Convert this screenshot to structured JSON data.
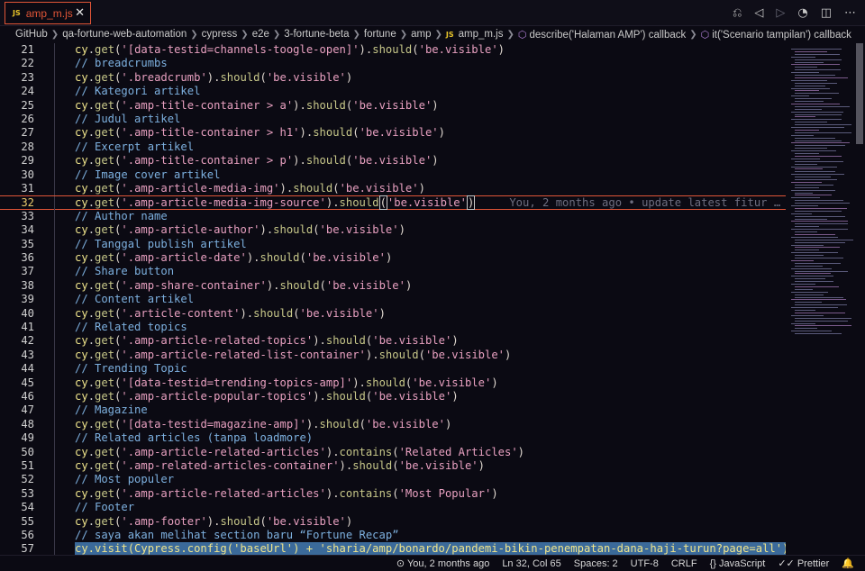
{
  "tab": {
    "icon": "JS",
    "name": "amp_m.js",
    "close": "✕"
  },
  "toolbar": [
    {
      "name": "source-control-icon",
      "glyph": "⎌"
    },
    {
      "name": "go-back-icon",
      "glyph": "◁"
    },
    {
      "name": "go-forward-icon",
      "glyph": "▷"
    },
    {
      "name": "timeline-icon",
      "glyph": "◔"
    },
    {
      "name": "split-editor-icon",
      "glyph": "◫"
    },
    {
      "name": "more-actions-icon",
      "glyph": "⋯"
    }
  ],
  "breadcrumb": [
    {
      "text": "GitHub"
    },
    {
      "text": "qa-fortune-web-automation"
    },
    {
      "text": "cypress"
    },
    {
      "text": "e2e"
    },
    {
      "text": "3-fortune-beta"
    },
    {
      "text": "fortune"
    },
    {
      "text": "amp"
    },
    {
      "text": "amp_m.js",
      "js": "JS"
    },
    {
      "text": "describe('Halaman AMP') callback",
      "sym": "⬡"
    },
    {
      "text": "it('Scenario tampilan') callback",
      "sym": "⬡"
    }
  ],
  "blame": "You, 2 months ago • update latest fitur …",
  "lines": [
    {
      "n": "21",
      "cy": "cy",
      "m1": "get",
      "a1": "'[data-testid=channels-toogle-open]'",
      "m2": "should",
      "a2": "'be.visible'"
    },
    {
      "n": "22",
      "comment": "// breadcrumbs"
    },
    {
      "n": "23",
      "cy": "cy",
      "m1": "get",
      "a1": "'.breadcrumb'",
      "m2": "should",
      "a2": "'be.visible'"
    },
    {
      "n": "24",
      "comment": "// Kategori artikel"
    },
    {
      "n": "25",
      "cy": "cy",
      "m1": "get",
      "a1": "'.amp-title-container > a'",
      "m2": "should",
      "a2": "'be.visible'"
    },
    {
      "n": "26",
      "comment": "// Judul artikel"
    },
    {
      "n": "27",
      "cy": "cy",
      "m1": "get",
      "a1": "'.amp-title-container > h1'",
      "m2": "should",
      "a2": "'be.visible'"
    },
    {
      "n": "28",
      "comment": "// Excerpt artikel"
    },
    {
      "n": "29",
      "cy": "cy",
      "m1": "get",
      "a1": "'.amp-title-container > p'",
      "m2": "should",
      "a2": "'be.visible'"
    },
    {
      "n": "30",
      "comment": "// Image cover artikel"
    },
    {
      "n": "31",
      "cy": "cy",
      "m1": "get",
      "a1": "'.amp-article-media-img'",
      "m2": "should",
      "a2": "'be.visible'"
    },
    {
      "n": "32",
      "cy": "cy",
      "m1": "get",
      "a1": "'.amp-article-media-img-source'",
      "m2": "should",
      "a2": "'be.visible'",
      "current": true
    },
    {
      "n": "33",
      "comment": "// Author name"
    },
    {
      "n": "34",
      "cy": "cy",
      "m1": "get",
      "a1": "'.amp-article-author'",
      "m2": "should",
      "a2": "'be.visible'"
    },
    {
      "n": "35",
      "comment": "// Tanggal publish artikel"
    },
    {
      "n": "36",
      "cy": "cy",
      "m1": "get",
      "a1": "'.amp-article-date'",
      "m2": "should",
      "a2": "'be.visible'"
    },
    {
      "n": "37",
      "comment": "// Share button"
    },
    {
      "n": "38",
      "cy": "cy",
      "m1": "get",
      "a1": "'.amp-share-container'",
      "m2": "should",
      "a2": "'be.visible'"
    },
    {
      "n": "39",
      "comment": "// Content artikel"
    },
    {
      "n": "40",
      "cy": "cy",
      "m1": "get",
      "a1": "'.article-content'",
      "m2": "should",
      "a2": "'be.visible'"
    },
    {
      "n": "41",
      "comment": "// Related topics"
    },
    {
      "n": "42",
      "cy": "cy",
      "m1": "get",
      "a1": "'.amp-article-related-topics'",
      "m2": "should",
      "a2": "'be.visible'"
    },
    {
      "n": "43",
      "cy": "cy",
      "m1": "get",
      "a1": "'.amp-article-related-list-container'",
      "m2": "should",
      "a2": "'be.visible'"
    },
    {
      "n": "44",
      "comment": "// Trending Topic"
    },
    {
      "n": "45",
      "cy": "cy",
      "m1": "get",
      "a1": "'[data-testid=trending-topics-amp]'",
      "m2": "should",
      "a2": "'be.visible'"
    },
    {
      "n": "46",
      "cy": "cy",
      "m1": "get",
      "a1": "'.amp-article-popular-topics'",
      "m2": "should",
      "a2": "'be.visible'"
    },
    {
      "n": "47",
      "comment": "// Magazine"
    },
    {
      "n": "48",
      "cy": "cy",
      "m1": "get",
      "a1": "'[data-testid=magazine-amp]'",
      "m2": "should",
      "a2": "'be.visible'"
    },
    {
      "n": "49",
      "comment": "// Related articles (tanpa loadmore)"
    },
    {
      "n": "50",
      "cy": "cy",
      "m1": "get",
      "a1": "'.amp-article-related-articles'",
      "m2": "contains",
      "a2": "'Related Articles'"
    },
    {
      "n": "51",
      "cy": "cy",
      "m1": "get",
      "a1": "'.amp-related-articles-container'",
      "m2": "should",
      "a2": "'be.visible'"
    },
    {
      "n": "52",
      "comment": "// Most populer"
    },
    {
      "n": "53",
      "cy": "cy",
      "m1": "get",
      "a1": "'.amp-article-related-articles'",
      "m2": "contains",
      "a2": "'Most Popular'"
    },
    {
      "n": "54",
      "comment": "// Footer"
    },
    {
      "n": "55",
      "cy": "cy",
      "m1": "get",
      "a1": "'.amp-footer'",
      "m2": "should",
      "a2": "'be.visible'"
    },
    {
      "n": "56",
      "comment": "// saya akan melihat section baru “Fortune Recap”"
    },
    {
      "n": "57",
      "raw": "cy.visit(Cypress.config('baseUrl') + 'sharia/amp/bonardo/pandemi-bikin-penempatan-dana-haji-turun?page=all')",
      "selected": true
    }
  ],
  "status": [
    {
      "name": "status-git-blame",
      "text": "⊙ You, 2 months ago"
    },
    {
      "name": "status-cursor-position",
      "text": "Ln 32, Col 65"
    },
    {
      "name": "status-indentation",
      "text": "Spaces: 2"
    },
    {
      "name": "status-encoding",
      "text": "UTF-8"
    },
    {
      "name": "status-eol",
      "text": "CRLF"
    },
    {
      "name": "status-language",
      "text": "{} JavaScript"
    },
    {
      "name": "status-prettier",
      "text": "✓✓ Prettier"
    },
    {
      "name": "status-notifications",
      "text": "🔔"
    }
  ]
}
